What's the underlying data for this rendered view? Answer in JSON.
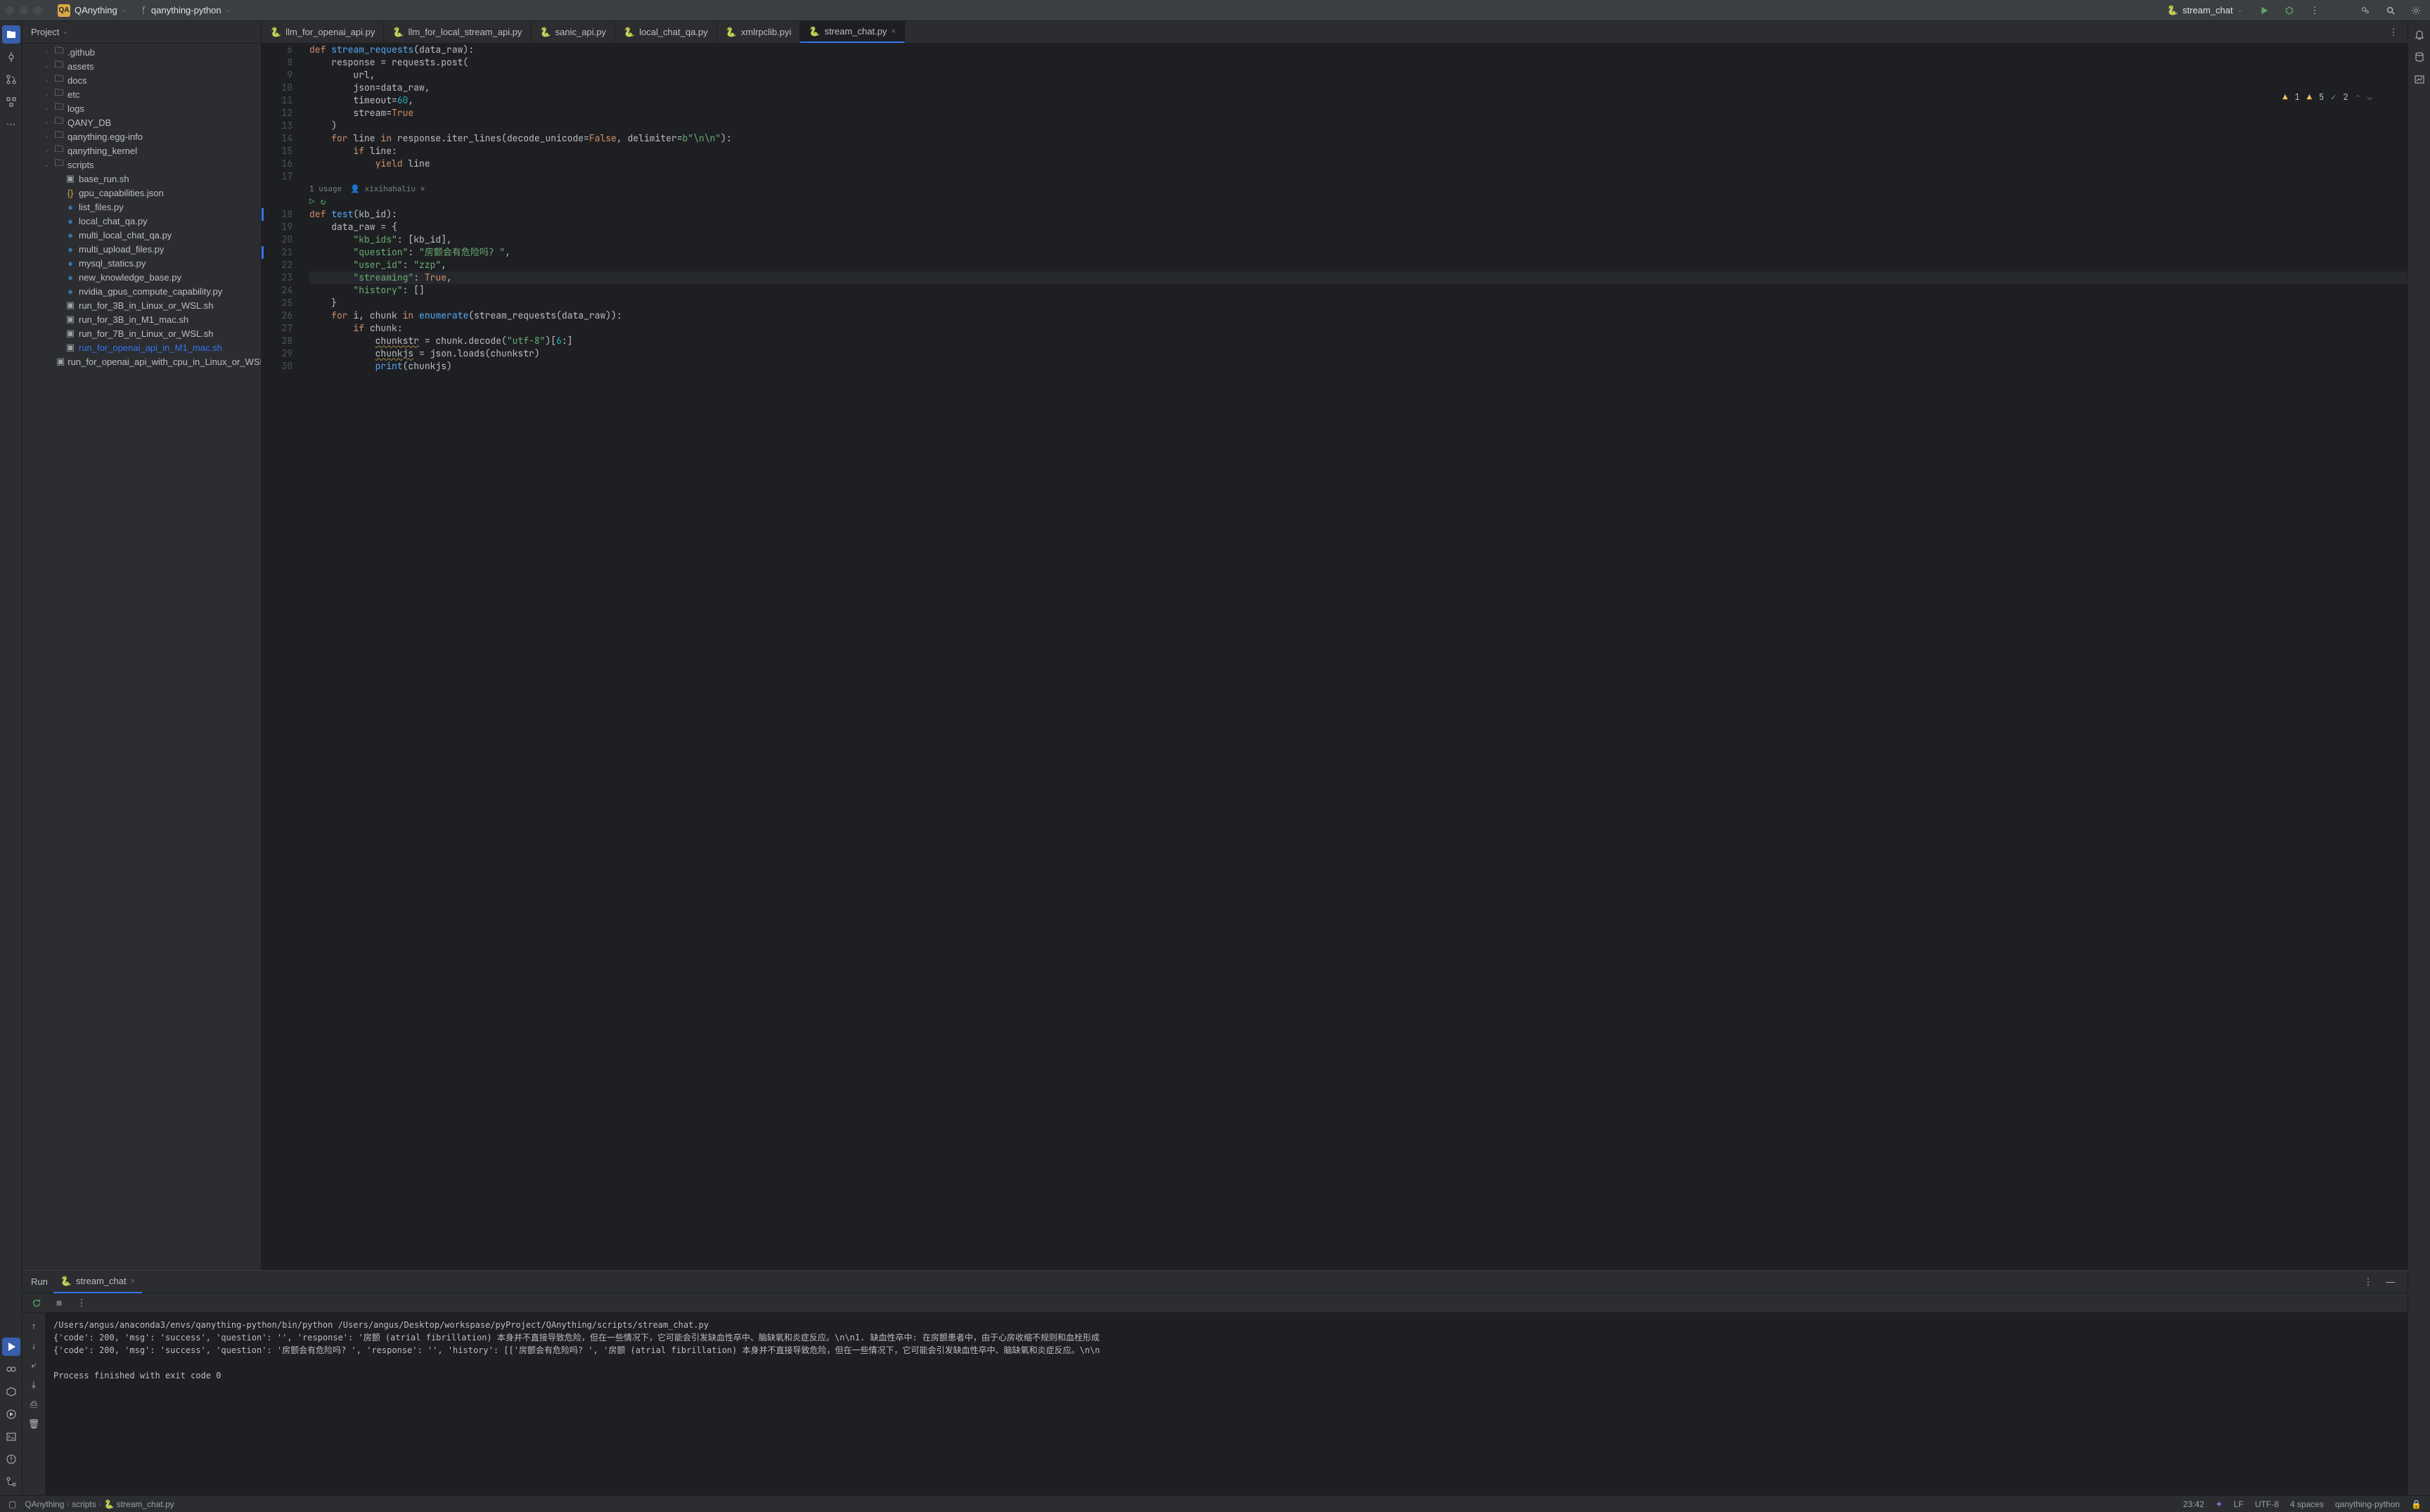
{
  "titlebar": {
    "project_badge": "QA",
    "project_name": "QAnything",
    "module_name": "qanything-python",
    "run_config": "stream_chat"
  },
  "tree": {
    "header": "Project",
    "items": [
      {
        "depth": 1,
        "arrow": "›",
        "type": "folder",
        "label": ".github"
      },
      {
        "depth": 1,
        "arrow": "›",
        "type": "folder",
        "label": "assets"
      },
      {
        "depth": 1,
        "arrow": "›",
        "type": "folder",
        "label": "docs"
      },
      {
        "depth": 1,
        "arrow": "›",
        "type": "folder",
        "label": "etc"
      },
      {
        "depth": 1,
        "arrow": "›",
        "type": "folder",
        "label": "logs"
      },
      {
        "depth": 1,
        "arrow": "›",
        "type": "folder",
        "label": "QANY_DB"
      },
      {
        "depth": 1,
        "arrow": "›",
        "type": "folder",
        "label": "qanything.egg-info"
      },
      {
        "depth": 1,
        "arrow": "›",
        "type": "folder",
        "label": "qanything_kernel"
      },
      {
        "depth": 1,
        "arrow": "⌄",
        "type": "folder",
        "label": "scripts"
      },
      {
        "depth": 2,
        "arrow": "",
        "type": "sh",
        "label": "base_run.sh"
      },
      {
        "depth": 2,
        "arrow": "",
        "type": "json",
        "label": "gpu_capabilities.json"
      },
      {
        "depth": 2,
        "arrow": "",
        "type": "py",
        "label": "list_files.py"
      },
      {
        "depth": 2,
        "arrow": "",
        "type": "py",
        "label": "local_chat_qa.py"
      },
      {
        "depth": 2,
        "arrow": "",
        "type": "py",
        "label": "multi_local_chat_qa.py"
      },
      {
        "depth": 2,
        "arrow": "",
        "type": "py",
        "label": "multi_upload_files.py"
      },
      {
        "depth": 2,
        "arrow": "",
        "type": "py",
        "label": "mysql_statics.py"
      },
      {
        "depth": 2,
        "arrow": "",
        "type": "py",
        "label": "new_knowledge_base.py"
      },
      {
        "depth": 2,
        "arrow": "",
        "type": "py",
        "label": "nvidia_gpus_compute_capability.py"
      },
      {
        "depth": 2,
        "arrow": "",
        "type": "sh",
        "label": "run_for_3B_in_Linux_or_WSL.sh"
      },
      {
        "depth": 2,
        "arrow": "",
        "type": "sh",
        "label": "run_for_3B_in_M1_mac.sh"
      },
      {
        "depth": 2,
        "arrow": "",
        "type": "sh",
        "label": "run_for_7B_in_Linux_or_WSL.sh"
      },
      {
        "depth": 2,
        "arrow": "",
        "type": "sh",
        "label": "run_for_openai_api_in_M1_mac.sh",
        "link": true
      },
      {
        "depth": 2,
        "arrow": "",
        "type": "sh",
        "label": "run_for_openai_api_with_cpu_in_Linux_or_WSL.sh"
      }
    ]
  },
  "tabs": [
    {
      "label": "llm_for_openai_api.py",
      "active": false
    },
    {
      "label": "llm_for_local_stream_api.py",
      "active": false
    },
    {
      "label": "sanic_api.py",
      "active": false
    },
    {
      "label": "local_chat_qa.py",
      "active": false
    },
    {
      "label": "xmlrpclib.pyi",
      "active": false
    },
    {
      "label": "stream_chat.py",
      "active": true,
      "closable": true
    }
  ],
  "inspections": {
    "warn": "1",
    "weak": "5",
    "ok": "2"
  },
  "usage": {
    "count": "1 usage",
    "author": "xixihahaliu *"
  },
  "gutter_start": 6,
  "code_lines": [
    {
      "n": 6,
      "html": "<span class='kw'>def</span> <span class='fn'>stream_requests</span>(data_raw):"
    },
    {
      "n": 8,
      "html": "    response = requests.post("
    },
    {
      "n": 9,
      "html": "        url,"
    },
    {
      "n": 10,
      "html": "        <span class='param'>json</span>=data_raw,"
    },
    {
      "n": 11,
      "html": "        <span class='param'>timeout</span>=<span class='num'>60</span>,"
    },
    {
      "n": 12,
      "html": "        <span class='param'>stream</span>=<span class='bool'>True</span>"
    },
    {
      "n": 13,
      "html": "    )"
    },
    {
      "n": 14,
      "html": "    <span class='kw'>for</span> line <span class='kw'>in</span> response.iter_lines(<span class='param'>decode_unicode</span>=<span class='bool'>False</span>, <span class='param'>delimiter</span>=<span class='str'>b\"\\n\\n\"</span>):"
    },
    {
      "n": 15,
      "html": "        <span class='kw'>if</span> line:"
    },
    {
      "n": 16,
      "html": "            <span class='kw'>yield</span> line"
    },
    {
      "n": 17,
      "html": ""
    },
    {
      "usage": true
    },
    {
      "n": 18,
      "mark": true,
      "html": "<span class='kw'>def</span> <span class='fn'>test</span>(kb_id):"
    },
    {
      "n": 19,
      "html": "    data_raw = {"
    },
    {
      "n": 20,
      "html": "        <span class='str'>\"kb_ids\"</span>: [kb_id],"
    },
    {
      "n": 21,
      "mark": true,
      "html": "        <span class='str'>\"question\"</span>: <span class='str'>\"房颤会有危险吗? \"</span>,"
    },
    {
      "n": 22,
      "html": "        <span class='str'>\"user_id\"</span>: <span class='str'>\"zzp\"</span>,"
    },
    {
      "n": 23,
      "hl": true,
      "html": "        <span class='str'>\"streaming\"</span>: <span class='bool'>True</span>,"
    },
    {
      "n": 24,
      "html": "        <span class='str'>\"history\"</span>: []"
    },
    {
      "n": 25,
      "html": "    }"
    },
    {
      "n": 26,
      "html": "    <span class='kw'>for</span> i, chunk <span class='kw'>in</span> <span class='fn'>enumerate</span>(stream_requests(data_raw)):"
    },
    {
      "n": 27,
      "html": "        <span class='kw'>if</span> chunk:"
    },
    {
      "n": 28,
      "html": "            <span class='underline'>chunkstr</span> = chunk.decode(<span class='str'>\"utf-8\"</span>)[<span class='num'>6</span>:]"
    },
    {
      "n": 29,
      "html": "            <span class='underline'>chunkjs</span> = json.loads(chunkstr)"
    },
    {
      "n": 30,
      "html": "            <span class='fn'>print</span>(chunkjs)"
    }
  ],
  "run": {
    "label": "Run",
    "tab": "stream_chat",
    "output": [
      "/Users/angus/anaconda3/envs/qanything-python/bin/python /Users/angus/Desktop/workspase/pyProject/QAnything/scripts/stream_chat.py",
      "{'code': 200, 'msg': 'success', 'question': '', 'response': '房颤 (atrial fibrillation) 本身并不直接导致危险，但在一些情况下，它可能会引发缺血性卒中、脑缺氧和炎症反应。\\n\\n1. 缺血性卒中: 在房颤患者中，由于心房收缩不规则和血栓形成",
      "{'code': 200, 'msg': 'success', 'question': '房颤会有危险吗? ', 'response': '', 'history': [['房颤会有危险吗? ', '房颤 (atrial fibrillation) 本身并不直接导致危险，但在一些情况下，它可能会引发缺血性卒中、脑缺氧和炎症反应。\\n\\n",
      "",
      "Process finished with exit code 0"
    ]
  },
  "breadcrumb": [
    "QAnything",
    "scripts",
    "stream_chat.py"
  ],
  "statusbar": {
    "pos": "23:42",
    "lf": "LF",
    "enc": "UTF-8",
    "indent": "4 spaces",
    "interp": "qanything-python"
  }
}
